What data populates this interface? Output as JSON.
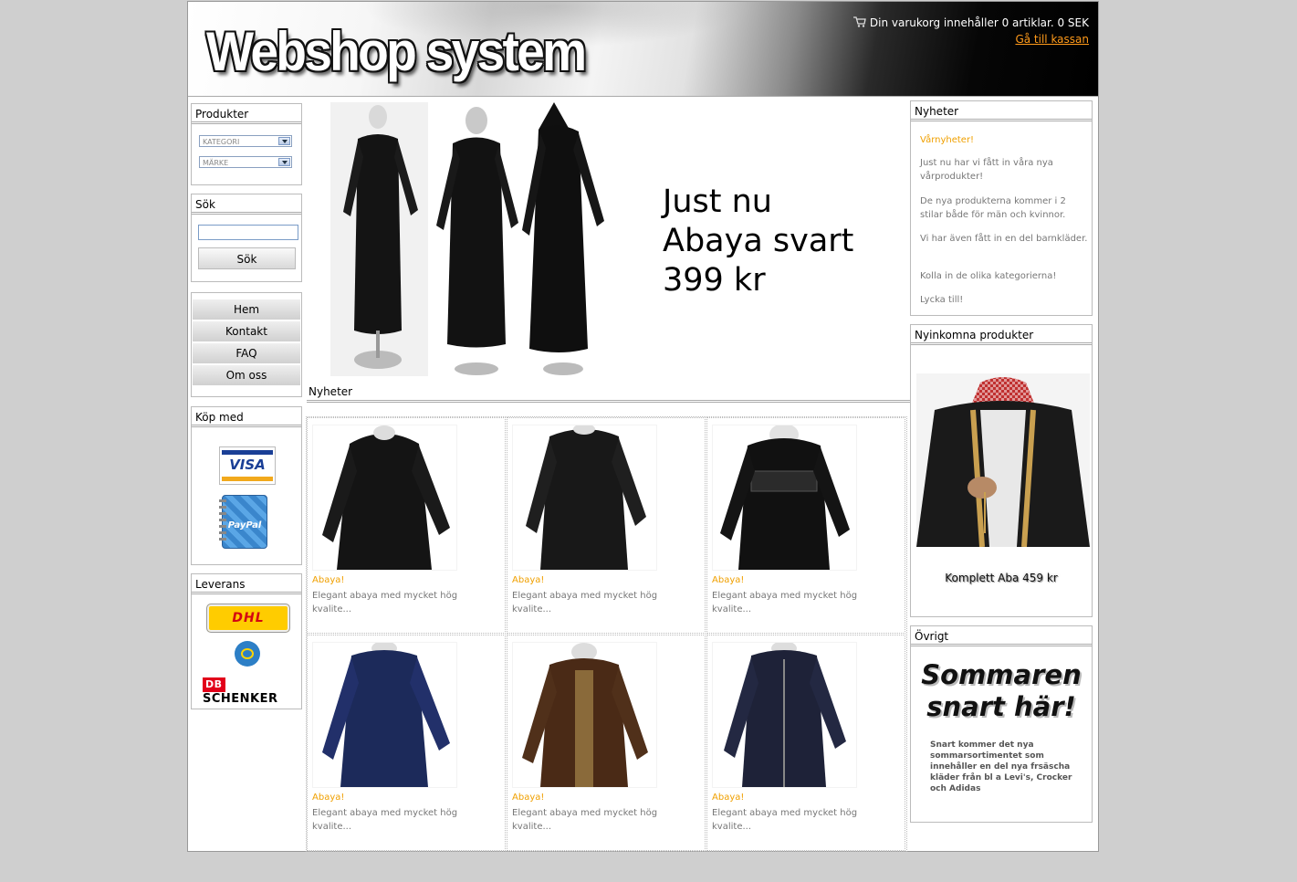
{
  "header": {
    "logo": "Webshop system",
    "cart_text": "Din varukorg innehåller 0 artiklar. 0 SEK",
    "checkout_link": "Gå till kassan"
  },
  "left": {
    "produkter": {
      "title": "Produkter",
      "category_select": "KATEGORI",
      "brand_select": "MÄRKE"
    },
    "sok": {
      "title": "Sök",
      "input_value": "",
      "button": "Sök"
    },
    "nav": [
      {
        "label": "Hem"
      },
      {
        "label": "Kontakt"
      },
      {
        "label": "FAQ"
      },
      {
        "label": "Om oss"
      }
    ],
    "kop_med": {
      "title": "Köp med",
      "visa": "VISA",
      "paypal": "PayPal"
    },
    "leverans": {
      "title": "Leverans",
      "dhl": "DHL",
      "schenker_db": "DB",
      "schenker": "SCHENKER"
    }
  },
  "hero": {
    "line1": "Just nu",
    "line2": "Abaya svart",
    "line3": "399 kr"
  },
  "news": {
    "title": "Nyheter",
    "products": [
      {
        "title": "Abaya!",
        "desc": "Elegant abaya med mycket hög kvalite...",
        "color": "#141414"
      },
      {
        "title": "Abaya!",
        "desc": "Elegant abaya med mycket hög kvalite...",
        "color": "#181818"
      },
      {
        "title": "Abaya!",
        "desc": "Elegant abaya med mycket hög kvalite...",
        "color": "#111111"
      },
      {
        "title": "Abaya!",
        "desc": "Elegant abaya med mycket hög kvalite...",
        "color": "#1c2a5a"
      },
      {
        "title": "Abaya!",
        "desc": "Elegant abaya med mycket hög kvalite...",
        "color": "#4a2a16"
      },
      {
        "title": "Abaya!",
        "desc": "Elegant abaya med mycket hög kvalite...",
        "color": "#1e2238"
      }
    ]
  },
  "right": {
    "nyheter": {
      "title": "Nyheter",
      "headline": "Vårnyheter!",
      "p1": "Just nu har vi fått in våra nya vårprodukter!",
      "p2": "De nya produkterna kommer i 2 stilar både för män och kvinnor.",
      "p3": "Vi har även fått in en del barnkläder.",
      "p4": "Kolla in de olika kategorierna!",
      "p5": "Lycka till!"
    },
    "nyinkomna": {
      "title": "Nyinkomna produkter",
      "caption": "Komplett Aba 459 kr"
    },
    "ovrigt": {
      "title": "Övrigt",
      "promo_line1": "Sommaren",
      "promo_line2": "snart här!",
      "promo_text": "Snart kommer det nya sommarsortimentet som innehåller en del nya frsäscha kläder från bl a Levi's, Crocker och Adidas"
    }
  },
  "colors": {
    "accent_orange": "#f0a000",
    "link_orange": "#ff9a1a",
    "border_gray": "#bbbbbb"
  }
}
